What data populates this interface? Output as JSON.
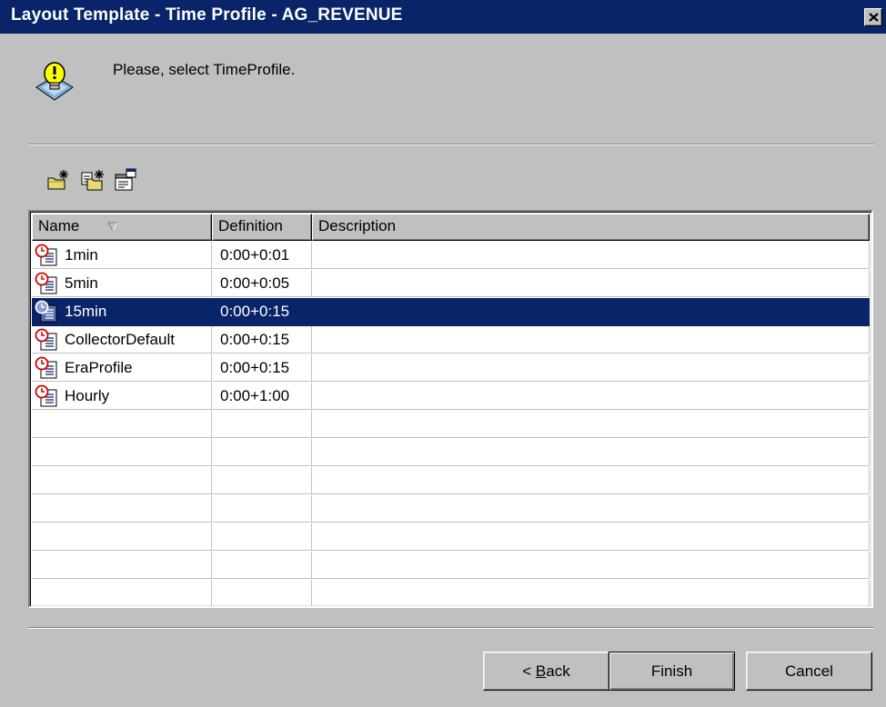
{
  "window": {
    "title": "Layout Template - Time Profile - AG_REVENUE",
    "title_bar_color": "#0a246a"
  },
  "message": {
    "icon": "lightbulb-hint-icon",
    "text": "Please, select TimeProfile."
  },
  "toolbar": {
    "buttons": [
      {
        "icon": "new-profile-icon"
      },
      {
        "icon": "copy-profile-icon"
      },
      {
        "icon": "profile-properties-icon"
      }
    ]
  },
  "list": {
    "columns": [
      {
        "label": "Name",
        "sorted": "descending"
      },
      {
        "label": "Definition"
      },
      {
        "label": "Description"
      }
    ],
    "rows": [
      {
        "name": "1min",
        "definition": "0:00+0:01",
        "description": "",
        "selected": false
      },
      {
        "name": "5min",
        "definition": "0:00+0:05",
        "description": "",
        "selected": false
      },
      {
        "name": "15min",
        "definition": "0:00+0:15",
        "description": "",
        "selected": true
      },
      {
        "name": "CollectorDefault",
        "definition": "0:00+0:15",
        "description": "",
        "selected": false
      },
      {
        "name": "EraProfile",
        "definition": "0:00+0:15",
        "description": "",
        "selected": false
      },
      {
        "name": "Hourly",
        "definition": "0:00+1:00",
        "description": "",
        "selected": false
      }
    ],
    "selection_color": "#0a246a",
    "row_icon": "time-profile-icon"
  },
  "buttons": {
    "back_prefix": "< ",
    "back_mnemonic": "B",
    "back_rest": "ack",
    "finish": "Finish",
    "cancel": "Cancel"
  }
}
